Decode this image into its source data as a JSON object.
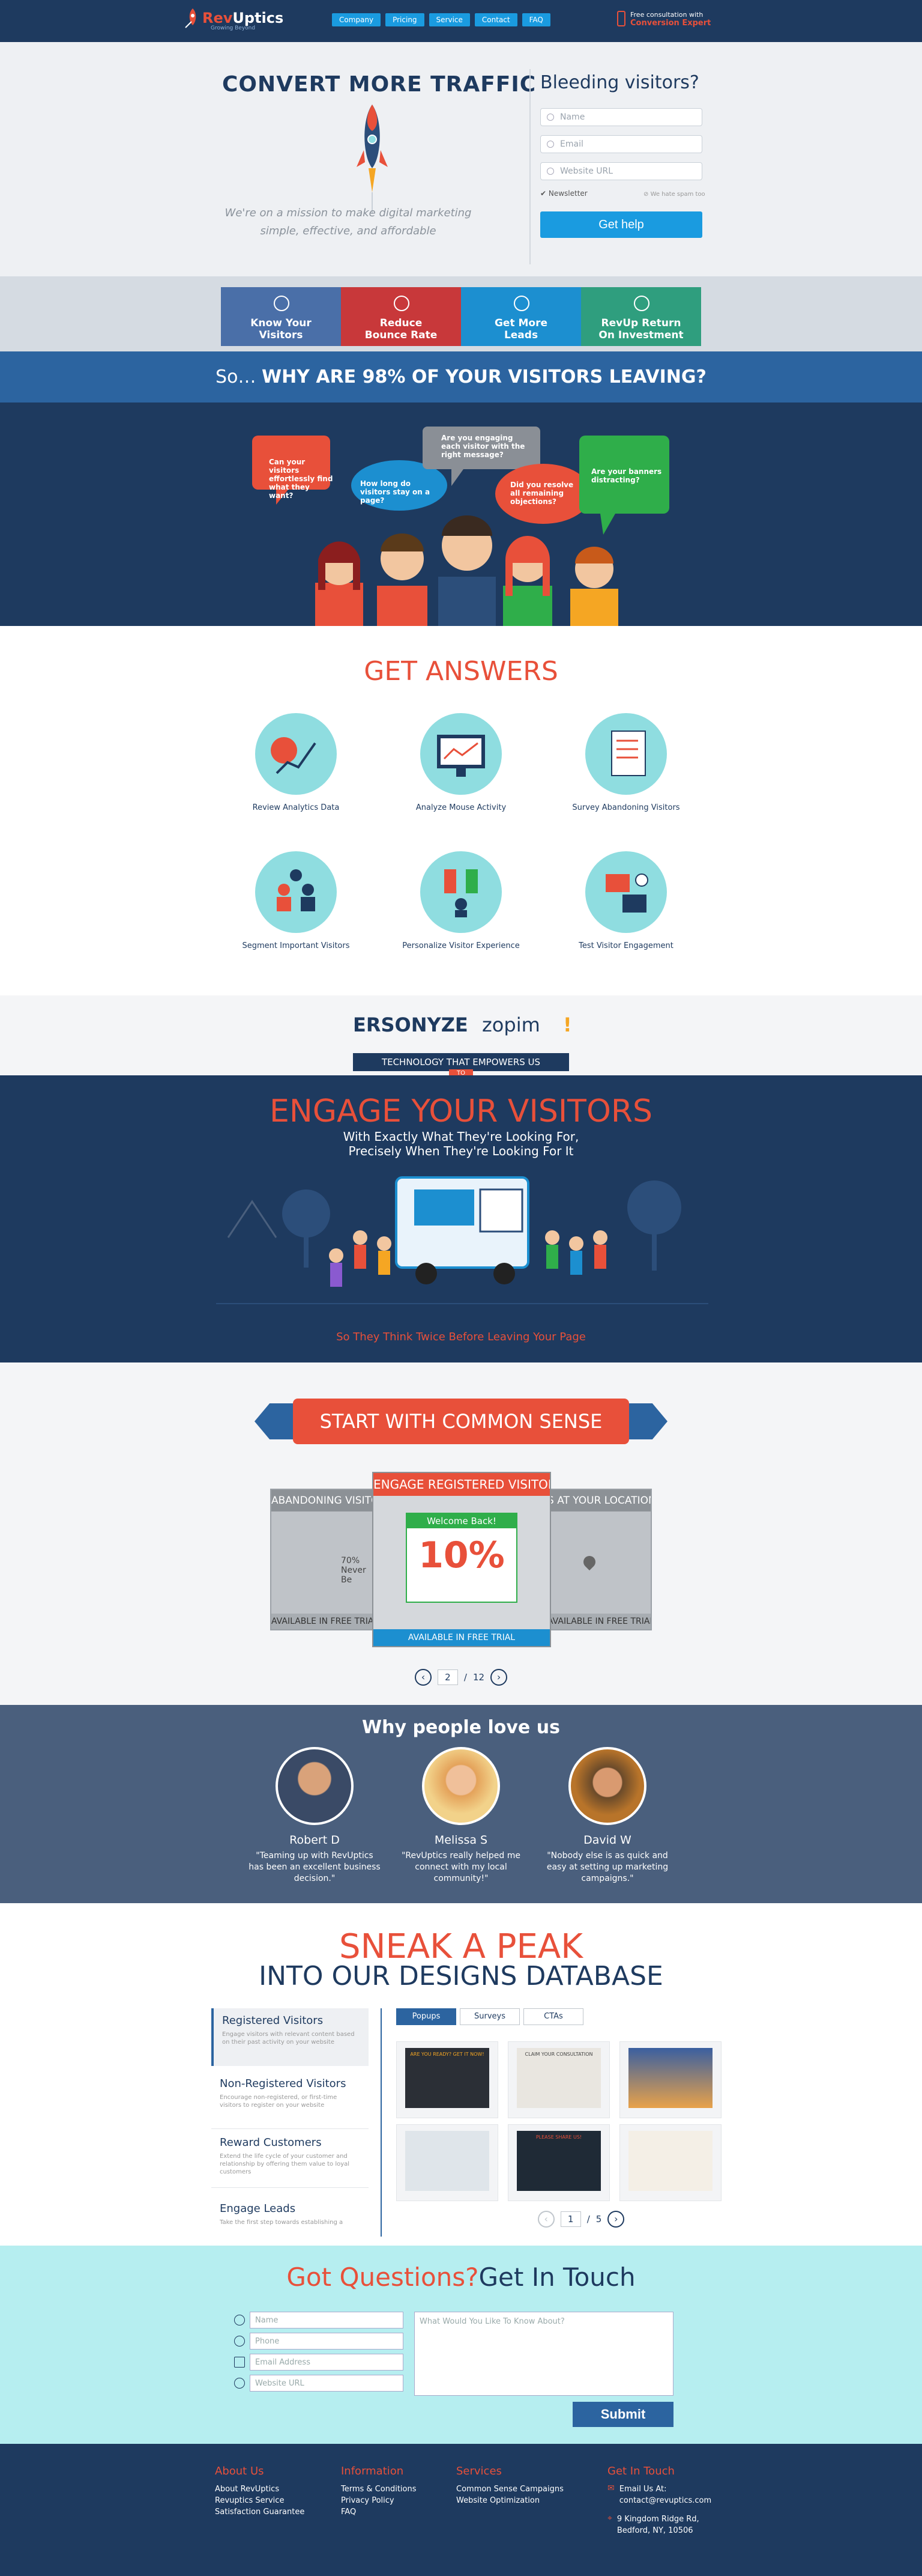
{
  "header": {
    "logo_prefix": "Rev",
    "logo_suffix": "Uptics",
    "logo_tagline": "Growing Beyond",
    "nav": [
      "Company",
      "Pricing",
      "Service",
      "Contact",
      "FAQ"
    ],
    "consult_line1": "Free consultation with",
    "consult_line2": "Conversion Expert",
    "colors": {
      "navy": "#1e3a5f",
      "blue": "#1a9be0",
      "accent": "#e8503a"
    }
  },
  "hero": {
    "title": "CONVERT MORE TRAFFIC",
    "mission": "We're on a mission to make digital marketing simple, effective, and affordable",
    "form_title": "Bleeding visitors?",
    "placeholders": {
      "name": "Name",
      "email": "Email",
      "url": "Website URL"
    },
    "newsletter_label": "Newsletter",
    "no_spam": "We hate spam too",
    "submit": "Get help"
  },
  "tiles": [
    {
      "label1": "Know Your",
      "label2": "Visitors",
      "icon": "location-icon",
      "color": "#4a6fa8"
    },
    {
      "label1": "Reduce",
      "label2": "Bounce Rate",
      "icon": "no-bounce-icon",
      "color": "#c8383a"
    },
    {
      "label1": "Get More",
      "label2": "Leads",
      "icon": "handshake-icon",
      "color": "#1c8fd0"
    },
    {
      "label1": "RevUp Return",
      "label2": "On Investment",
      "icon": "growth-chart-icon",
      "color": "#2f9e7e"
    }
  ],
  "why": {
    "prefix": "So… ",
    "text": "WHY ARE 98% OF YOUR VISITORS LEAVING?"
  },
  "bubbles": [
    {
      "text": "Can your visitors effortlessly find what they want?",
      "color": "#e8503a"
    },
    {
      "text": "How long do visitors stay on a page?",
      "color": "#1c8fd0"
    },
    {
      "text": "Are you engaging each visitor with the right message?",
      "color": "#8a8f96"
    },
    {
      "text": "Did you resolve all remaining objections?",
      "color": "#e8503a"
    },
    {
      "text": "Are your banners distracting?",
      "color": "#2fae4a"
    }
  ],
  "answers": {
    "title": "GET ANSWERS",
    "items": [
      {
        "label": "Review Analytics Data",
        "icon": "analytics-icon"
      },
      {
        "label": "Analyze Mouse Activity",
        "icon": "monitor-icon"
      },
      {
        "label": "Survey Abandoning Visitors",
        "icon": "survey-icon"
      },
      {
        "label": "Segment Important Visitors",
        "icon": "segment-icon"
      },
      {
        "label": "Personalize Visitor Experience",
        "icon": "personalize-icon"
      },
      {
        "label": "Test Visitor Engagement",
        "icon": "ab-test-icon"
      }
    ]
  },
  "partners": {
    "logos": [
      "ERSONYZE",
      "zopim",
      "!"
    ],
    "band": "TECHNOLOGY THAT EMPOWERS US",
    "band_sub": "TO"
  },
  "engage": {
    "title": "ENGAGE YOUR VISITORS",
    "subtitle1": "With Exactly What They're Looking For,",
    "subtitle2": "Precisely When They're Looking For It",
    "bottom": "So They Think Twice Before Leaving Your Page"
  },
  "common_sense": {
    "title": "START WITH COMMON SENSE",
    "cards": [
      {
        "title": "ABANDONING VISITORS",
        "footer": "AVAILABLE IN FREE TRIAL"
      },
      {
        "title": "ENGAGE REGISTERED VISITORS",
        "footer": "AVAILABLE IN FREE TRIAL",
        "popup": "Welcome Back!",
        "percent": "10%"
      },
      {
        "title": "S AT YOUR LOCATION",
        "footer": "AVAILABLE IN FREE TRIAL"
      }
    ],
    "side_text": "70% Never Be",
    "page": "2",
    "total": "12"
  },
  "love": {
    "title": "Why people love us",
    "people": [
      {
        "name": "Robert D",
        "quote": "\"Teaming up with RevUptics has been an excellent business decision.\""
      },
      {
        "name": "Melissa S",
        "quote": "\"RevUptics really helped me connect with my local community!\""
      },
      {
        "name": "David W",
        "quote": "\"Nobody else is as quick and easy at setting up marketing campaigns.\""
      }
    ]
  },
  "sneak": {
    "title1": "SNEAK A PEAK",
    "title2": "INTO OUR DESIGNS DATABASE",
    "side": [
      {
        "name": "Registered Visitors",
        "desc": "Engage visitors with relevant content based on their past activity on your website"
      },
      {
        "name": "Non-Registered Visitors",
        "desc": "Encourage non-registered, or first-time visitors to register on your website"
      },
      {
        "name": "Reward Customers",
        "desc": "Extend the life cycle of your customer and relationship by offering them value to loyal customers"
      },
      {
        "name": "Engage Leads",
        "desc": "Take the first step towards establishing a"
      }
    ],
    "tabs": [
      "Popups",
      "Surveys",
      "CTAs"
    ],
    "thumbs": [
      {
        "caption": "ARE YOU READY? GET IT NOW!"
      },
      {
        "caption": "CLAIM YOUR CONSULTATION"
      },
      {
        "caption": ""
      },
      {
        "caption": ""
      },
      {
        "caption": "PLEASE SHARE US!"
      },
      {
        "caption": ""
      }
    ],
    "page": "1",
    "total": "5"
  },
  "contact": {
    "title_a": "Got Questions?",
    "title_b": "Get In Touch",
    "placeholders": {
      "name": "Name",
      "phone": "Phone",
      "email": "Email Address",
      "url": "Website URL",
      "message": "What Would You Like To Know About?"
    },
    "submit": "Submit"
  },
  "footer": {
    "about": {
      "h": "About Us",
      "items": [
        "About RevUptics",
        "Revuptics Service",
        "Satisfaction Guarantee"
      ]
    },
    "info": {
      "h": "Information",
      "items": [
        "Terms & Conditions",
        "Privacy Policy",
        "FAQ"
      ]
    },
    "services": {
      "h": "Services",
      "items": [
        "Common Sense Campaigns",
        "Website Optimization"
      ]
    },
    "touch": {
      "h": "Get In Touch",
      "email_label": "Email Us At:",
      "email": "contact@revuptics.com",
      "addr1": "9 Kingdom Ridge Rd,",
      "addr2": "Bedford, NY, 10506"
    }
  }
}
